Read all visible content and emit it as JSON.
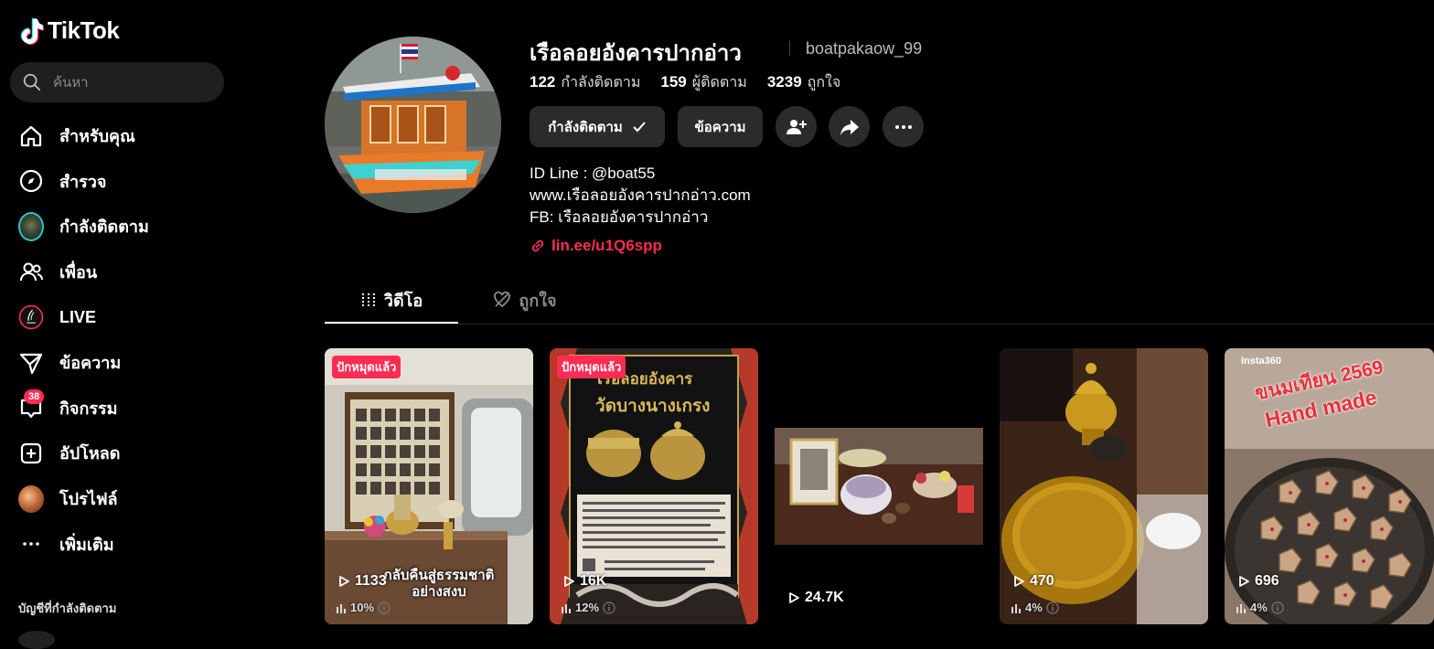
{
  "app": {
    "brand": "TikTok"
  },
  "search": {
    "placeholder": "ค้นหา"
  },
  "sidebar": {
    "items": [
      {
        "label": "สำหรับคุณ",
        "icon": "home-icon"
      },
      {
        "label": "สำรวจ",
        "icon": "compass-icon"
      },
      {
        "label": "กำลังติดตาม",
        "icon": "following-avatar"
      },
      {
        "label": "เพื่อน",
        "icon": "friends-icon"
      },
      {
        "label": "LIVE",
        "icon": "live-icon"
      },
      {
        "label": "ข้อความ",
        "icon": "send-icon"
      },
      {
        "label": "กิจกรรม",
        "icon": "inbox-icon",
        "badge": "38"
      },
      {
        "label": "อัปโหลด",
        "icon": "upload-icon"
      },
      {
        "label": "โปรไฟล์",
        "icon": "profile-avatar"
      },
      {
        "label": "เพิ่มเติม",
        "icon": "more-icon"
      }
    ],
    "following_title": "บัญชีที่กำลังติดตาม"
  },
  "profile": {
    "name": "เรือลอยอังคารปากอ่าว",
    "username": "boatpakaow_99",
    "stats": {
      "following_count": "122",
      "following_label": "กำลังติดตาม",
      "followers_count": "159",
      "followers_label": "ผู้ติดตาม",
      "likes_count": "3239",
      "likes_label": "ถูกใจ"
    },
    "buttons": {
      "following": "กำลังติดตาม",
      "message": "ข้อความ"
    },
    "bio": [
      "ID Line : @boat55",
      "www.เรือลอยอังคารปากอ่าว.com",
      "FB: เรือลอยอังคารปากอ่าว"
    ],
    "link": "lin.ee/u1Q6spp"
  },
  "tabs": {
    "videos": "วิดีโอ",
    "liked": "ถูกใจ"
  },
  "videos": [
    {
      "pinned": "ปักหมุดแล้ว",
      "views": "1133",
      "percent": "10%",
      "caption": "กลับคืนสู่ธรรมชาติ อย่างสงบ"
    },
    {
      "pinned": "ปักหมุดแล้ว",
      "views": "16K",
      "percent": "12%",
      "sign_title": "เรือลอยอังคาร",
      "sign_subtitle": "วัดบางนางเกรง"
    },
    {
      "views": "24.7K"
    },
    {
      "views": "470",
      "percent": "4%"
    },
    {
      "views": "696",
      "percent": "4%",
      "watermark": "Insta360",
      "title_line1": "ขนมเทียน 2569",
      "title_line2": "Hand made"
    }
  ],
  "colors": {
    "accent": "#fe2c55",
    "background": "#000000",
    "button": "#2b2b2b"
  }
}
